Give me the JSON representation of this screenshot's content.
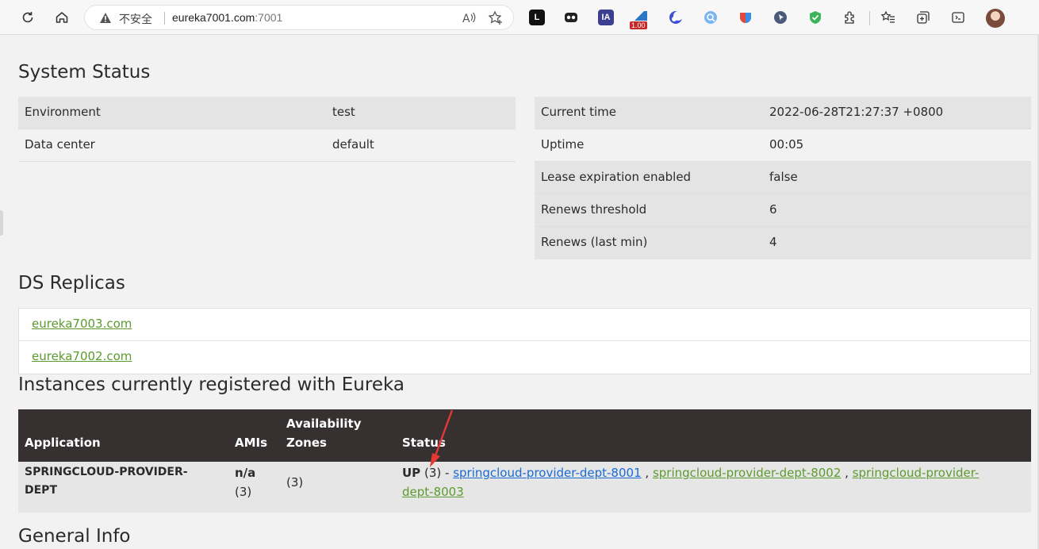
{
  "browser": {
    "insecure_label": "不安全",
    "url_host": "eureka7001.com",
    "url_port": ":7001",
    "extension_badge": "1.00",
    "ext_ia_label": "IA",
    "ext_l_label": "L"
  },
  "system_status": {
    "title": "System Status",
    "left": [
      {
        "key": "Environment",
        "value": "test"
      },
      {
        "key": "Data center",
        "value": "default"
      }
    ],
    "right": [
      {
        "key": "Current time",
        "value": "2022-06-28T21:27:37 +0800"
      },
      {
        "key": "Uptime",
        "value": "00:05"
      },
      {
        "key": "Lease expiration enabled",
        "value": "false"
      },
      {
        "key": "Renews threshold",
        "value": "6"
      },
      {
        "key": "Renews (last min)",
        "value": "4"
      }
    ]
  },
  "replicas": {
    "title": "DS Replicas",
    "items": [
      "eureka7003.com",
      "eureka7002.com"
    ]
  },
  "instances": {
    "title": "Instances currently registered with Eureka",
    "headers": {
      "application": "Application",
      "amis": "AMIs",
      "zones_1": "Availability",
      "zones_2": "Zones",
      "status": "Status"
    },
    "row": {
      "application_1": "SPRINGCLOUD-PROVIDER-",
      "application_2": "DEPT",
      "amis_value": "n/a",
      "amis_count": "(3)",
      "zones": "(3)",
      "status_up": "UP",
      "status_count": "(3) -",
      "instance_1": "springcloud-provider-dept-8001",
      "instance_2": "springcloud-provider-dept-8002",
      "instance_3a": "springcloud-provider-",
      "instance_3b": "dept-8003",
      "comma": ","
    }
  },
  "general_info": {
    "title": "General Info"
  },
  "colors": {
    "header_bg": "#363030",
    "link_green": "#5c9b2f",
    "link_blue": "#1a6ad6",
    "arrow": "#e53935"
  }
}
